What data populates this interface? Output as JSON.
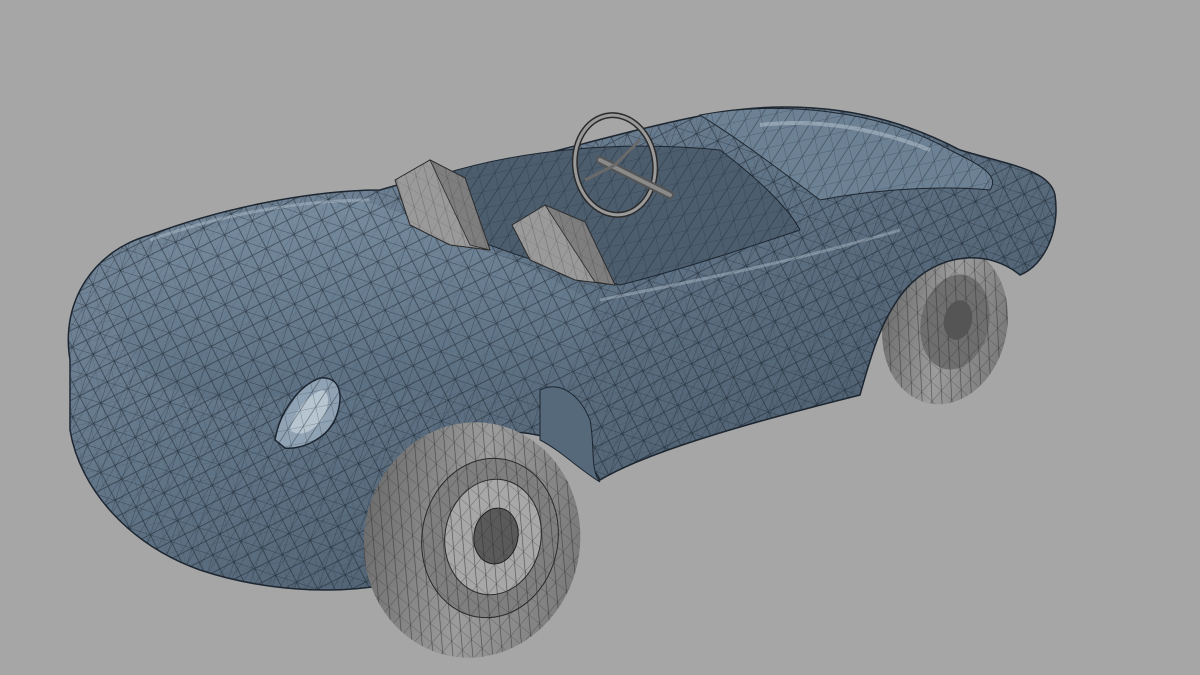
{
  "scene": {
    "background_color": "#a6a6a6",
    "body_color": "#5f7386",
    "wire_color": "#1d2630",
    "wheel_color": "#8d8d8d",
    "seat_color": "#9a9a9a"
  }
}
